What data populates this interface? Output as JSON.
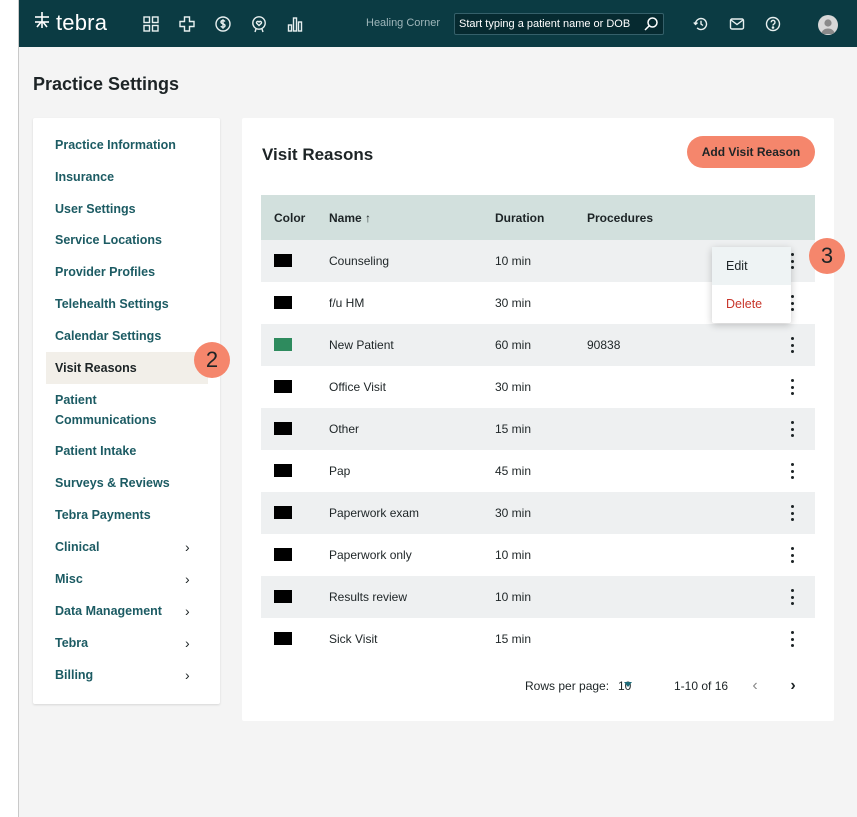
{
  "topbar": {
    "logo_text": "tebra",
    "practice_name": "Healing Corner",
    "search_placeholder": "Start typing a patient name or DOB",
    "nav_icons": [
      "grid-icon",
      "medical-cross-icon",
      "dollar-icon",
      "heart-badge-icon",
      "bar-chart-icon"
    ],
    "right_icons": [
      "history-icon",
      "mail-icon",
      "help-icon",
      "user-avatar-icon"
    ]
  },
  "page": {
    "title": "Practice Settings"
  },
  "sidebar": {
    "items": [
      {
        "label": "Practice Information"
      },
      {
        "label": "Insurance"
      },
      {
        "label": "User Settings"
      },
      {
        "label": "Service Locations"
      },
      {
        "label": "Provider Profiles"
      },
      {
        "label": "Telehealth Settings"
      },
      {
        "label": "Calendar Settings"
      },
      {
        "label": "Visit Reasons",
        "active": true
      },
      {
        "label": "Patient Communications"
      },
      {
        "label": "Patient Intake"
      },
      {
        "label": "Surveys & Reviews"
      },
      {
        "label": "Tebra Payments"
      },
      {
        "label": "Clinical",
        "expandable": true
      },
      {
        "label": "Misc",
        "expandable": true
      },
      {
        "label": "Data Management",
        "expandable": true
      },
      {
        "label": "Tebra",
        "expandable": true
      },
      {
        "label": "Billing",
        "expandable": true
      }
    ],
    "chevron": "›"
  },
  "main": {
    "title": "Visit Reasons",
    "add_button": "Add Visit Reason",
    "columns": {
      "color": "Color",
      "name": "Name ↑",
      "duration": "Duration",
      "procedures": "Procedures"
    },
    "rows": [
      {
        "color": "#000000",
        "name": "Counseling",
        "duration": "10 min",
        "procedures": ""
      },
      {
        "color": "#000000",
        "name": "f/u HM",
        "duration": "30 min",
        "procedures": ""
      },
      {
        "color": "#2e8b5e",
        "name": "New Patient",
        "duration": "60 min",
        "procedures": "90838"
      },
      {
        "color": "#000000",
        "name": "Office Visit",
        "duration": "30 min",
        "procedures": ""
      },
      {
        "color": "#000000",
        "name": "Other",
        "duration": "15 min",
        "procedures": ""
      },
      {
        "color": "#000000",
        "name": "Pap",
        "duration": "45 min",
        "procedures": ""
      },
      {
        "color": "#000000",
        "name": "Paperwork exam",
        "duration": "30 min",
        "procedures": ""
      },
      {
        "color": "#000000",
        "name": "Paperwork only",
        "duration": "10 min",
        "procedures": ""
      },
      {
        "color": "#000000",
        "name": "Results review",
        "duration": "10 min",
        "procedures": ""
      },
      {
        "color": "#000000",
        "name": "Sick Visit",
        "duration": "15 min",
        "procedures": ""
      }
    ],
    "pagination": {
      "rows_per_page_label": "Rows per page:",
      "rows_per_page": "10",
      "range": "1-10 of 16",
      "prev": "‹",
      "next": "›"
    }
  },
  "context_menu": {
    "edit": "Edit",
    "delete": "Delete"
  },
  "step_badges": {
    "sidebar": "2",
    "menu": "3"
  },
  "colors": {
    "topbar": "#0b3b43",
    "accent": "#f5866c",
    "link": "#1c5b63",
    "header_row": "#d2e0dd",
    "danger": "#c8362b"
  }
}
